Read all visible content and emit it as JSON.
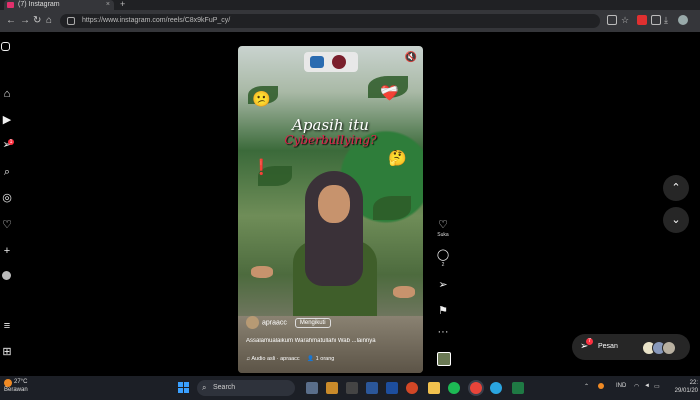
{
  "browser": {
    "tab_title": "(7) Instagram",
    "tab_close": "×",
    "new_tab": "+",
    "url": "https://www.instagram.com/reels/C8x9kFuP_cy/",
    "nav": {
      "back": "←",
      "forward": "→",
      "reload": "↻",
      "home": "⌂"
    }
  },
  "sidebar": {
    "notification_count": "1",
    "icons": [
      "instagram-icon",
      "home-icon",
      "reels-icon",
      "messages-icon",
      "search-icon",
      "explore-icon",
      "heart-icon",
      "create-icon",
      "profile-icon",
      "menu-icon",
      "threads-icon"
    ]
  },
  "reel": {
    "title_line1": "Apasih itu",
    "title_line2": "Cyberbullying?",
    "username": "apraacc",
    "follow_label": "Mengikuti",
    "caption": "Assalamualaikum Warahmatullahi Wab ...lainnya",
    "audio": "♫ Audio asli · apraacc",
    "tagged": "👤 1 orang",
    "emojis": {
      "e1": "😕",
      "e2": "❤️‍🩹",
      "e3": "🤔",
      "e4": "❗"
    }
  },
  "actions": {
    "like_label": "Suka",
    "comment_count": "2",
    "more": "···"
  },
  "messages": {
    "label": "Pesan",
    "badge": "7"
  },
  "taskbar": {
    "weather_temp": "27°C",
    "weather_desc": "Berawan",
    "search_placeholder": "Search",
    "lang": "IND",
    "time": "22:",
    "date": "29/01/20"
  }
}
